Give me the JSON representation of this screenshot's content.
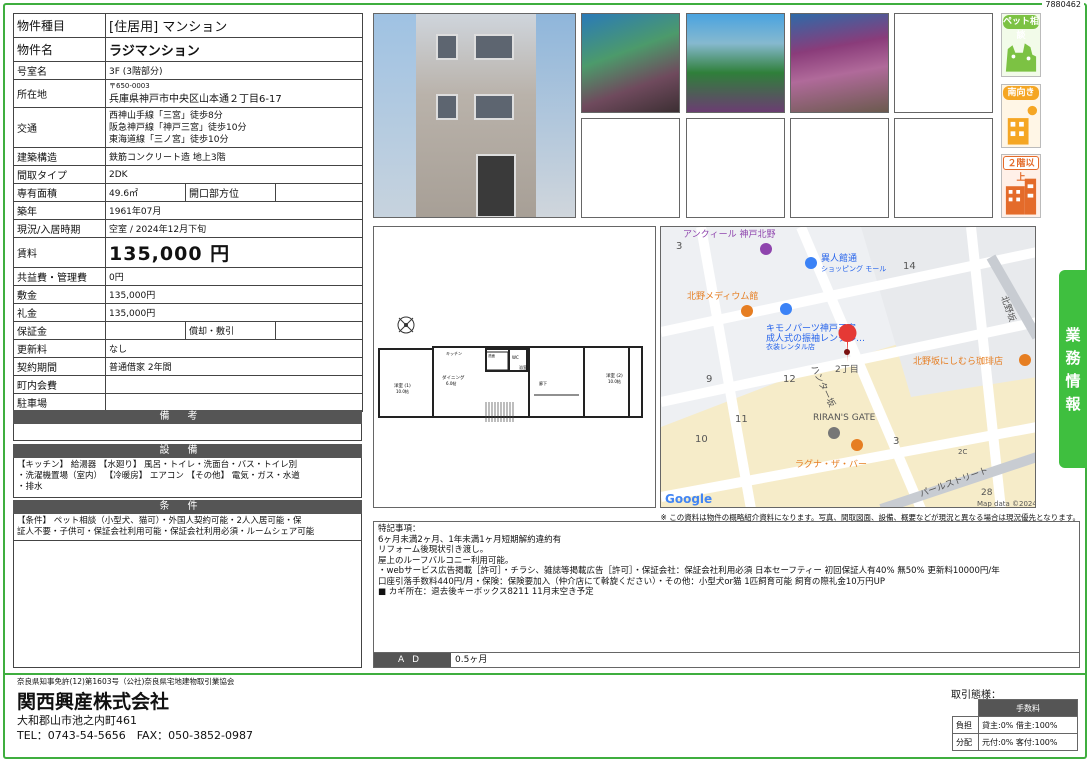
{
  "ref_no": "7880462",
  "spec": {
    "type_label": "物件種目",
    "type_value": "[住居用] マンション",
    "name_label": "物件名",
    "name_value": "ラジマンション",
    "room_label": "号室名",
    "room_value": "3F (3階部分)",
    "address_label": "所在地",
    "postal": "〒650-0003",
    "address_value": "兵庫県神戸市中央区山本通２丁目6-17",
    "transit_label": "交通",
    "transit_1": "西神山手線「三宮」徒歩8分",
    "transit_2": "阪急神戸線「神戸三宮」徒歩10分",
    "transit_3": "東海道線「三ノ宮」徒歩10分",
    "structure_label": "建築構造",
    "structure_value": "鉄筋コンクリート造 地上3階",
    "layout_label": "間取タイプ",
    "layout_value": "2DK",
    "area_label": "専有面積",
    "area_value": "49.6㎡",
    "window_label": "開口部方位",
    "window_value": "",
    "built_label": "築年",
    "built_value": "1961年07月",
    "status_label": "現況/入居時期",
    "status_value": "空室 / 2024年12月下旬",
    "rent_label": "賃料",
    "rent_value": "135,000 円",
    "fee_label": "共益費・管理費",
    "fee_value": "0円",
    "deposit_label": "敷金",
    "deposit_value": "135,000円",
    "keymoney_label": "礼金",
    "keymoney_value": "135,000円",
    "guarantee_label": "保証金",
    "guarantee_value": "",
    "amort_label": "償却・敷引",
    "amort_value": "",
    "renewal_label": "更新料",
    "renewal_value": "なし",
    "contract_label": "契約期間",
    "contract_value": "普通借家 2年間",
    "community_label": "町内会費",
    "community_value": "",
    "parking_label": "駐車場",
    "parking_value": ""
  },
  "sections": {
    "notes_title": "備考",
    "notes_body": "",
    "equip_title": "設備",
    "equip_body": "【キッチン】 給湯器 【水廻り】 風呂・トイレ・洗面台・バス・トイレ別\n・洗濯機置場（室内） 【冷暖房】 エアコン 【その他】 電気・ガス・水道\n・排水",
    "cond_title": "条件",
    "cond_body": "【条件】 ペット相談（小型犬、猫可）・外国人契約可能・2人入居可能・保\n証人不要・子供可・保証会社利用可能・保証会社利用必須・ルームシェア可能"
  },
  "badges": {
    "pet": "ペット相談",
    "south": "南向き",
    "floor2": "２階以上"
  },
  "side_tab": [
    "業",
    "務",
    "情",
    "報"
  ],
  "map": {
    "labels": {
      "ancueil": "アンクィール 神戸北野",
      "ijinkan": "異人館通",
      "ijinkan_sub": "ショッピング モール",
      "medium": "北野メディウム館",
      "kimono": "キモノパーツ神戸三宮",
      "kimono_2": "成人式の振袖レンタル…",
      "kimono_3": "衣装レンタル店",
      "kitano_zaka": "北野坂",
      "nishimura": "北野坂にしむら珈琲店",
      "rirans": "RIRAN'S GATE",
      "laguna": "ラグナ・ザ・バー",
      "hunter": "ハンター坂",
      "pearl": "パールストリート",
      "n3": "3",
      "n14": "14",
      "n9": "9",
      "n12": "12",
      "n2chome": "2丁目",
      "n11": "11",
      "n10": "10",
      "n3b": "3",
      "n2c": "2C",
      "n28": "28",
      "google": "Google",
      "mapdata": "Map data ©2024"
    }
  },
  "plan": {
    "kitchen": "キッチン",
    "dining": "ダイニング",
    "dining_sub": "6.0帖",
    "wash": "洗面",
    "wc": "WC",
    "bath": "浴室",
    "room1": "洋室 (1)",
    "room1_sub": "10.0帖",
    "room2": "洋室 (2)",
    "room2_sub": "10.0帖",
    "hall": "廊下"
  },
  "disclaimer": "※ この資料は物件の概略紹介資料になります。写真、間取図面、設備、概要などが現況と異なる場合は現況優先となります。",
  "remarks": {
    "text": "特記事項：\n6ヶ月未満2ヶ月、1年未満1ヶ月短期解約違約有\nリフォーム後現状引き渡し。\n屋上のルーフバルコニー利用可能。\n・webサービス広告掲載［許可］・チラシ、雑誌等掲載広告［許可］・保証会社：保証会社利用必須 日本セーフティー 初回保証人有40% 無50% 更新料10000円/年\n 口座引落手数料440円/月・保険：保険要加入（仲介店にて斡旋ください）・その他：小型犬or猫 1匹飼育可能 飼育の際礼金10万円UP\n■ カギ所在：退去後キーボックス8211 11月末空き予定",
    "ad_label": "AD",
    "ad_value": "0.5ヶ月"
  },
  "footer": {
    "license": "奈良県知事免許(12)第1603号（公社)奈良県宅地建物取引業協会",
    "company": "関西興産株式会社",
    "address": "大和郡山市池之内町461",
    "tel": "TEL：0743-54-5656　FAX：050-3852-0987"
  },
  "trade": {
    "title": "取引態様：",
    "fee_header": "手数料",
    "row1_label": "負担",
    "row1_value": "貸主:0% 借主:100%",
    "row2_label": "分配",
    "row2_value": "元付:0% 客付:100%"
  }
}
